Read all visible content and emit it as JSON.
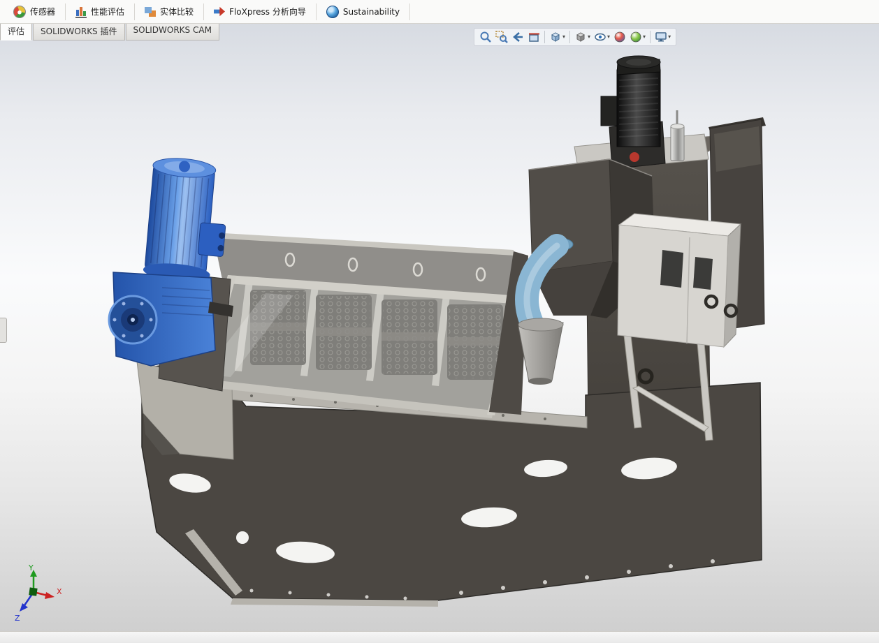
{
  "window": {
    "app": "SOLIDWORKS"
  },
  "ribbon": {
    "items": [
      {
        "label": "传感器",
        "icon": "sensor-gauge-icon"
      },
      {
        "label": "性能评估",
        "icon": "performance-evaluation-icon"
      },
      {
        "label": "实体比较",
        "icon": "compare-bodies-icon"
      },
      {
        "label": "FloXpress 分析向导",
        "icon": "floxpress-wizard-icon"
      },
      {
        "label": "Sustainability",
        "icon": "sustainability-globe-icon"
      }
    ]
  },
  "tabs": {
    "items": [
      {
        "label": "评估",
        "active": true
      },
      {
        "label": "SOLIDWORKS 插件",
        "active": false
      },
      {
        "label": "SOLIDWORKS CAM",
        "active": false
      }
    ]
  },
  "hud": {
    "tools": [
      {
        "name": "zoom-to-fit",
        "dropdown": false
      },
      {
        "name": "zoom-to-area",
        "dropdown": false
      },
      {
        "name": "previous-view",
        "dropdown": false
      },
      {
        "name": "section-view",
        "dropdown": false
      },
      {
        "name": "view-orientation",
        "dropdown": true
      },
      {
        "name": "display-style",
        "dropdown": true
      },
      {
        "name": "hide-show-items",
        "dropdown": true
      },
      {
        "name": "edit-appearance",
        "dropdown": false
      },
      {
        "name": "apply-scene",
        "dropdown": true
      },
      {
        "name": "view-settings",
        "dropdown": true
      }
    ]
  },
  "viewport": {
    "description": "3D shaded CAD model of a stacked screw-press sludge dewatering machine with blue drive motor, feed hopper, mixing tank, agitator motor, control cabinet and dark steel base frame",
    "colors": {
      "drive_motor_blue": "#2f62c2",
      "frame_dark": "#4b4742",
      "panel_beige": "#b7b4ad",
      "inlet_pipe_blue": "#8ab6d3",
      "gradient_top": "#d7dbe2",
      "gradient_bottom": "#cfcfcf"
    }
  },
  "triad": {
    "x_label": "X",
    "y_label": "Y",
    "z_label": "Z",
    "x_color": "#cc2222",
    "y_color": "#1f9a1f",
    "z_color": "#2233cc"
  },
  "status_bar": {
    "text": ""
  }
}
